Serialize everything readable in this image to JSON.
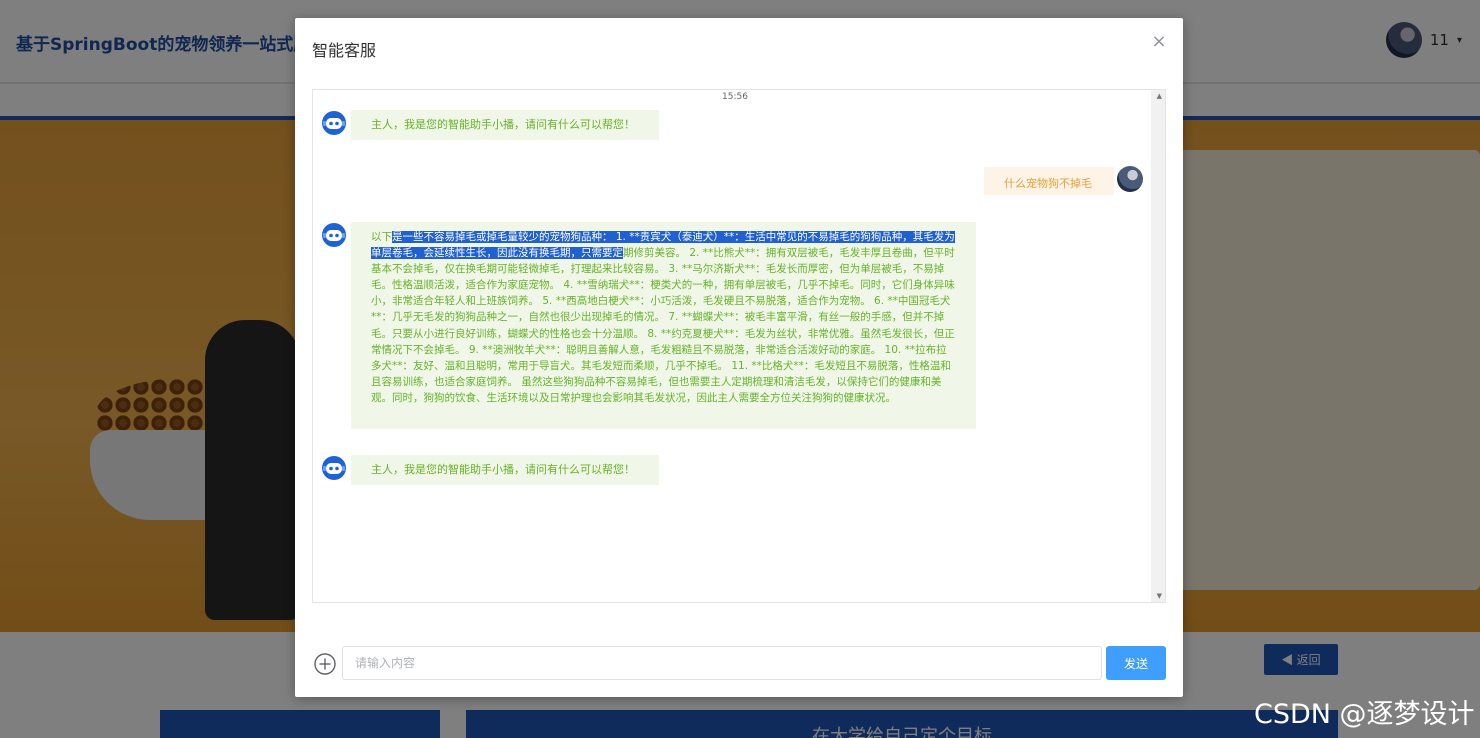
{
  "header": {
    "site_title": "基于SpringBoot的宠物领养一站式服",
    "username": "11",
    "caret": "▾"
  },
  "page": {
    "back_label": "返回",
    "card_text": "在大学给自己定个目标"
  },
  "dialog": {
    "title": "智能客服",
    "close_icon": "×",
    "timestamp": "15:56",
    "messages": {
      "bot1": "主人，我是您的智能助手小播，请问有什么可以帮您！",
      "user1": "什么宠物狗不掉毛",
      "bot2_pre": "以下",
      "bot2_highlight": "是一些不容易掉毛或掉毛量较少的宠物狗品种：  1. **贵宾犬（泰迪犬）**：生活中常见的不易掉毛的狗狗品种，其毛发为单层卷毛，会延续性生长，因此没有换毛期，只需要定",
      "bot2_rest": "期修剪美容。 2. **比熊犬**：拥有双层被毛，毛发丰厚且卷曲，但平时基本不会掉毛，仅在换毛期可能轻微掉毛，打理起来比较容易。 3. **马尔济斯犬**：毛发长而厚密，但为单层被毛，不易掉毛。性格温顺活泼，适合作为家庭宠物。 4. **雪纳瑞犬**：梗类犬的一种，拥有单层被毛，几乎不掉毛。同时，它们身体异味小，非常适合年轻人和上班族饲养。 5. **西高地白梗犬**：小巧活泼，毛发硬且不易脱落，适合作为宠物。 6. **中国冠毛犬**：几乎无毛发的狗狗品种之一，自然也很少出现掉毛的情况。 7. **蝴蝶犬**：被毛丰富平滑，有丝一般的手感，但并不掉毛。只要从小进行良好训练，蝴蝶犬的性格也会十分温顺。 8. **约克夏梗犬**：毛发为丝状，非常优雅。虽然毛发很长，但正常情况下不会掉毛。 9. **澳洲牧羊犬**：聪明且善解人意，毛发粗糙且不易脱落，非常适合活泼好动的家庭。 10. **拉布拉多犬**：友好、温和且聪明，常用于导盲犬。其毛发短而柔顺，几乎不掉毛。 11. **比格犬**：毛发短且不易脱落，性格温和且容易训练，也适合家庭饲养。 虽然这些狗狗品种不容易掉毛，但也需要主人定期梳理和清洁毛发，以保持它们的健康和美观。同时，狗狗的饮食、生活环境以及日常护理也会影响其毛发状况，因此主人需要全方位关注狗狗的健康状况。",
      "bot3": "主人，我是您的智能助手小播，请问有什么可以帮您！"
    },
    "input": {
      "placeholder": "请输入内容",
      "value": ""
    },
    "send_label": "发送"
  },
  "watermark": "CSDN @逐梦设计",
  "icons": {
    "bot": "robot-icon",
    "add": "plus-circle-icon",
    "close": "close-icon",
    "back": "caret-left-icon"
  },
  "colors": {
    "primary": "#409eff",
    "bot_bubble_bg": "#f0f7e8",
    "bot_text": "#67b229",
    "user_bubble_bg": "#fdf3e6",
    "user_text": "#e6a23c",
    "brand_blue": "#1e56b8",
    "selection": "#2060d0"
  }
}
